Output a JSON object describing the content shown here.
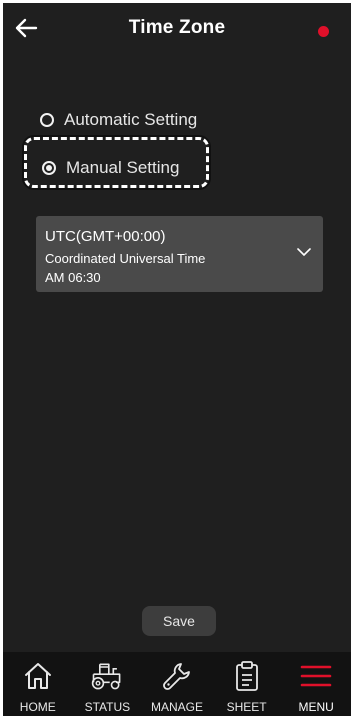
{
  "header": {
    "title": "Time Zone",
    "back_icon": "arrow-left-icon",
    "status_color": "#e0102a"
  },
  "options": {
    "automatic_label": "Automatic Setting",
    "manual_label": "Manual Setting",
    "selected": "manual"
  },
  "timezone": {
    "code": "UTC(GMT+00:00)",
    "name": "Coordinated Universal Time",
    "time": "AM 06:30"
  },
  "save_label": "Save",
  "nav": {
    "items": [
      {
        "label": "HOME",
        "icon": "home-icon"
      },
      {
        "label": "STATUS",
        "icon": "tractor-icon"
      },
      {
        "label": "MANAGE",
        "icon": "wrench-icon"
      },
      {
        "label": "SHEET",
        "icon": "clipboard-icon"
      },
      {
        "label": "MENU",
        "icon": "menu-icon"
      }
    ],
    "active": "MENU",
    "accent": "#e0102a"
  }
}
